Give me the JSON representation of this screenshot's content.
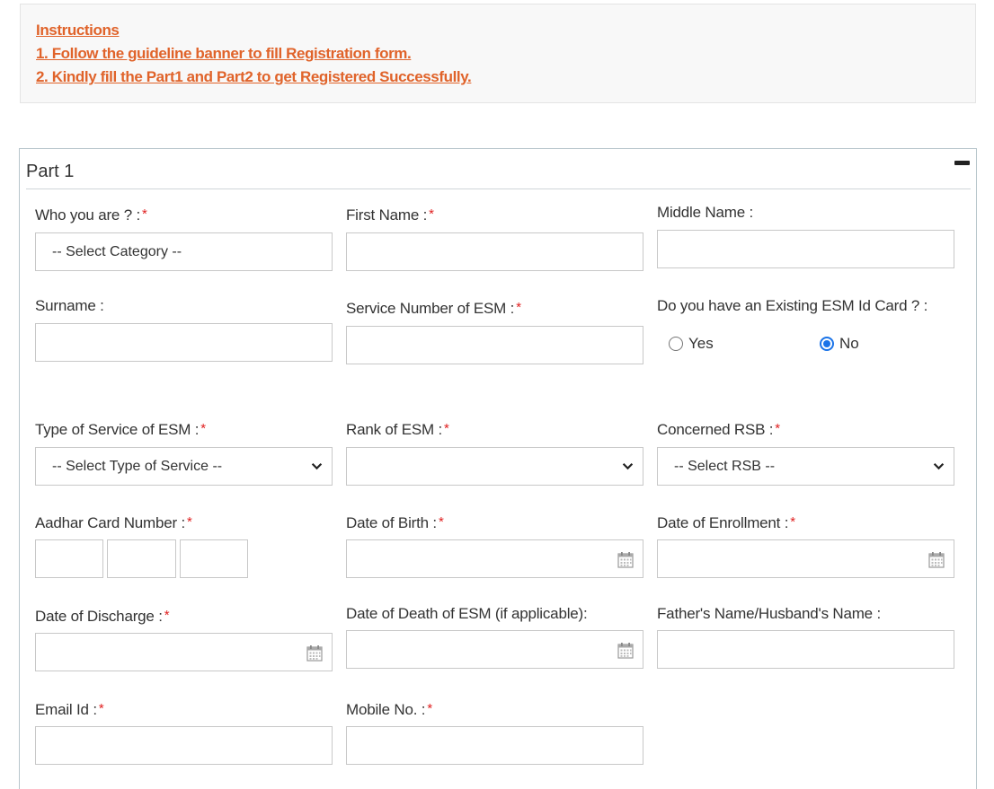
{
  "instructions": {
    "title": "Instructions",
    "line1": "1. Follow the guideline banner to fill Registration form.",
    "line2": "2. Kindly fill the Part1 and Part2 to get Registered Successfully."
  },
  "panel": {
    "title": "Part 1"
  },
  "form": {
    "who_you_are": {
      "label": "Who you are ? :",
      "value": "-- Select Category --"
    },
    "first_name": {
      "label": "First Name :",
      "value": ""
    },
    "middle_name": {
      "label": "Middle Name :",
      "value": ""
    },
    "surname": {
      "label": "Surname :",
      "value": ""
    },
    "service_number": {
      "label": "Service Number of ESM :",
      "value": ""
    },
    "existing_card": {
      "label": "Do you have an Existing ESM Id Card ? :",
      "yes": "Yes",
      "no": "No",
      "selected": "No"
    },
    "service_type": {
      "label": "Type of Service of ESM :",
      "value": "-- Select Type of Service --"
    },
    "rank": {
      "label": "Rank of ESM :",
      "value": ""
    },
    "rsb": {
      "label": "Concerned RSB :",
      "value": "-- Select RSB --"
    },
    "aadhar": {
      "label": "Aadhar Card Number :"
    },
    "dob": {
      "label": "Date of Birth :",
      "value": ""
    },
    "enrollment": {
      "label": "Date of Enrollment :",
      "value": ""
    },
    "discharge": {
      "label": "Date of Discharge :",
      "value": ""
    },
    "death": {
      "label": "Date of Death of ESM (if applicable):",
      "value": ""
    },
    "father_name": {
      "label": "Father's Name/Husband's Name :",
      "value": ""
    },
    "email": {
      "label": "Email Id :",
      "value": ""
    },
    "mobile": {
      "label": "Mobile No. :",
      "value": ""
    },
    "required_marker": "*"
  },
  "colors": {
    "instruction_text": "#e0632a",
    "required": "#e02020",
    "radio_accent": "#1a73e8",
    "border": "#c8c8c8"
  }
}
